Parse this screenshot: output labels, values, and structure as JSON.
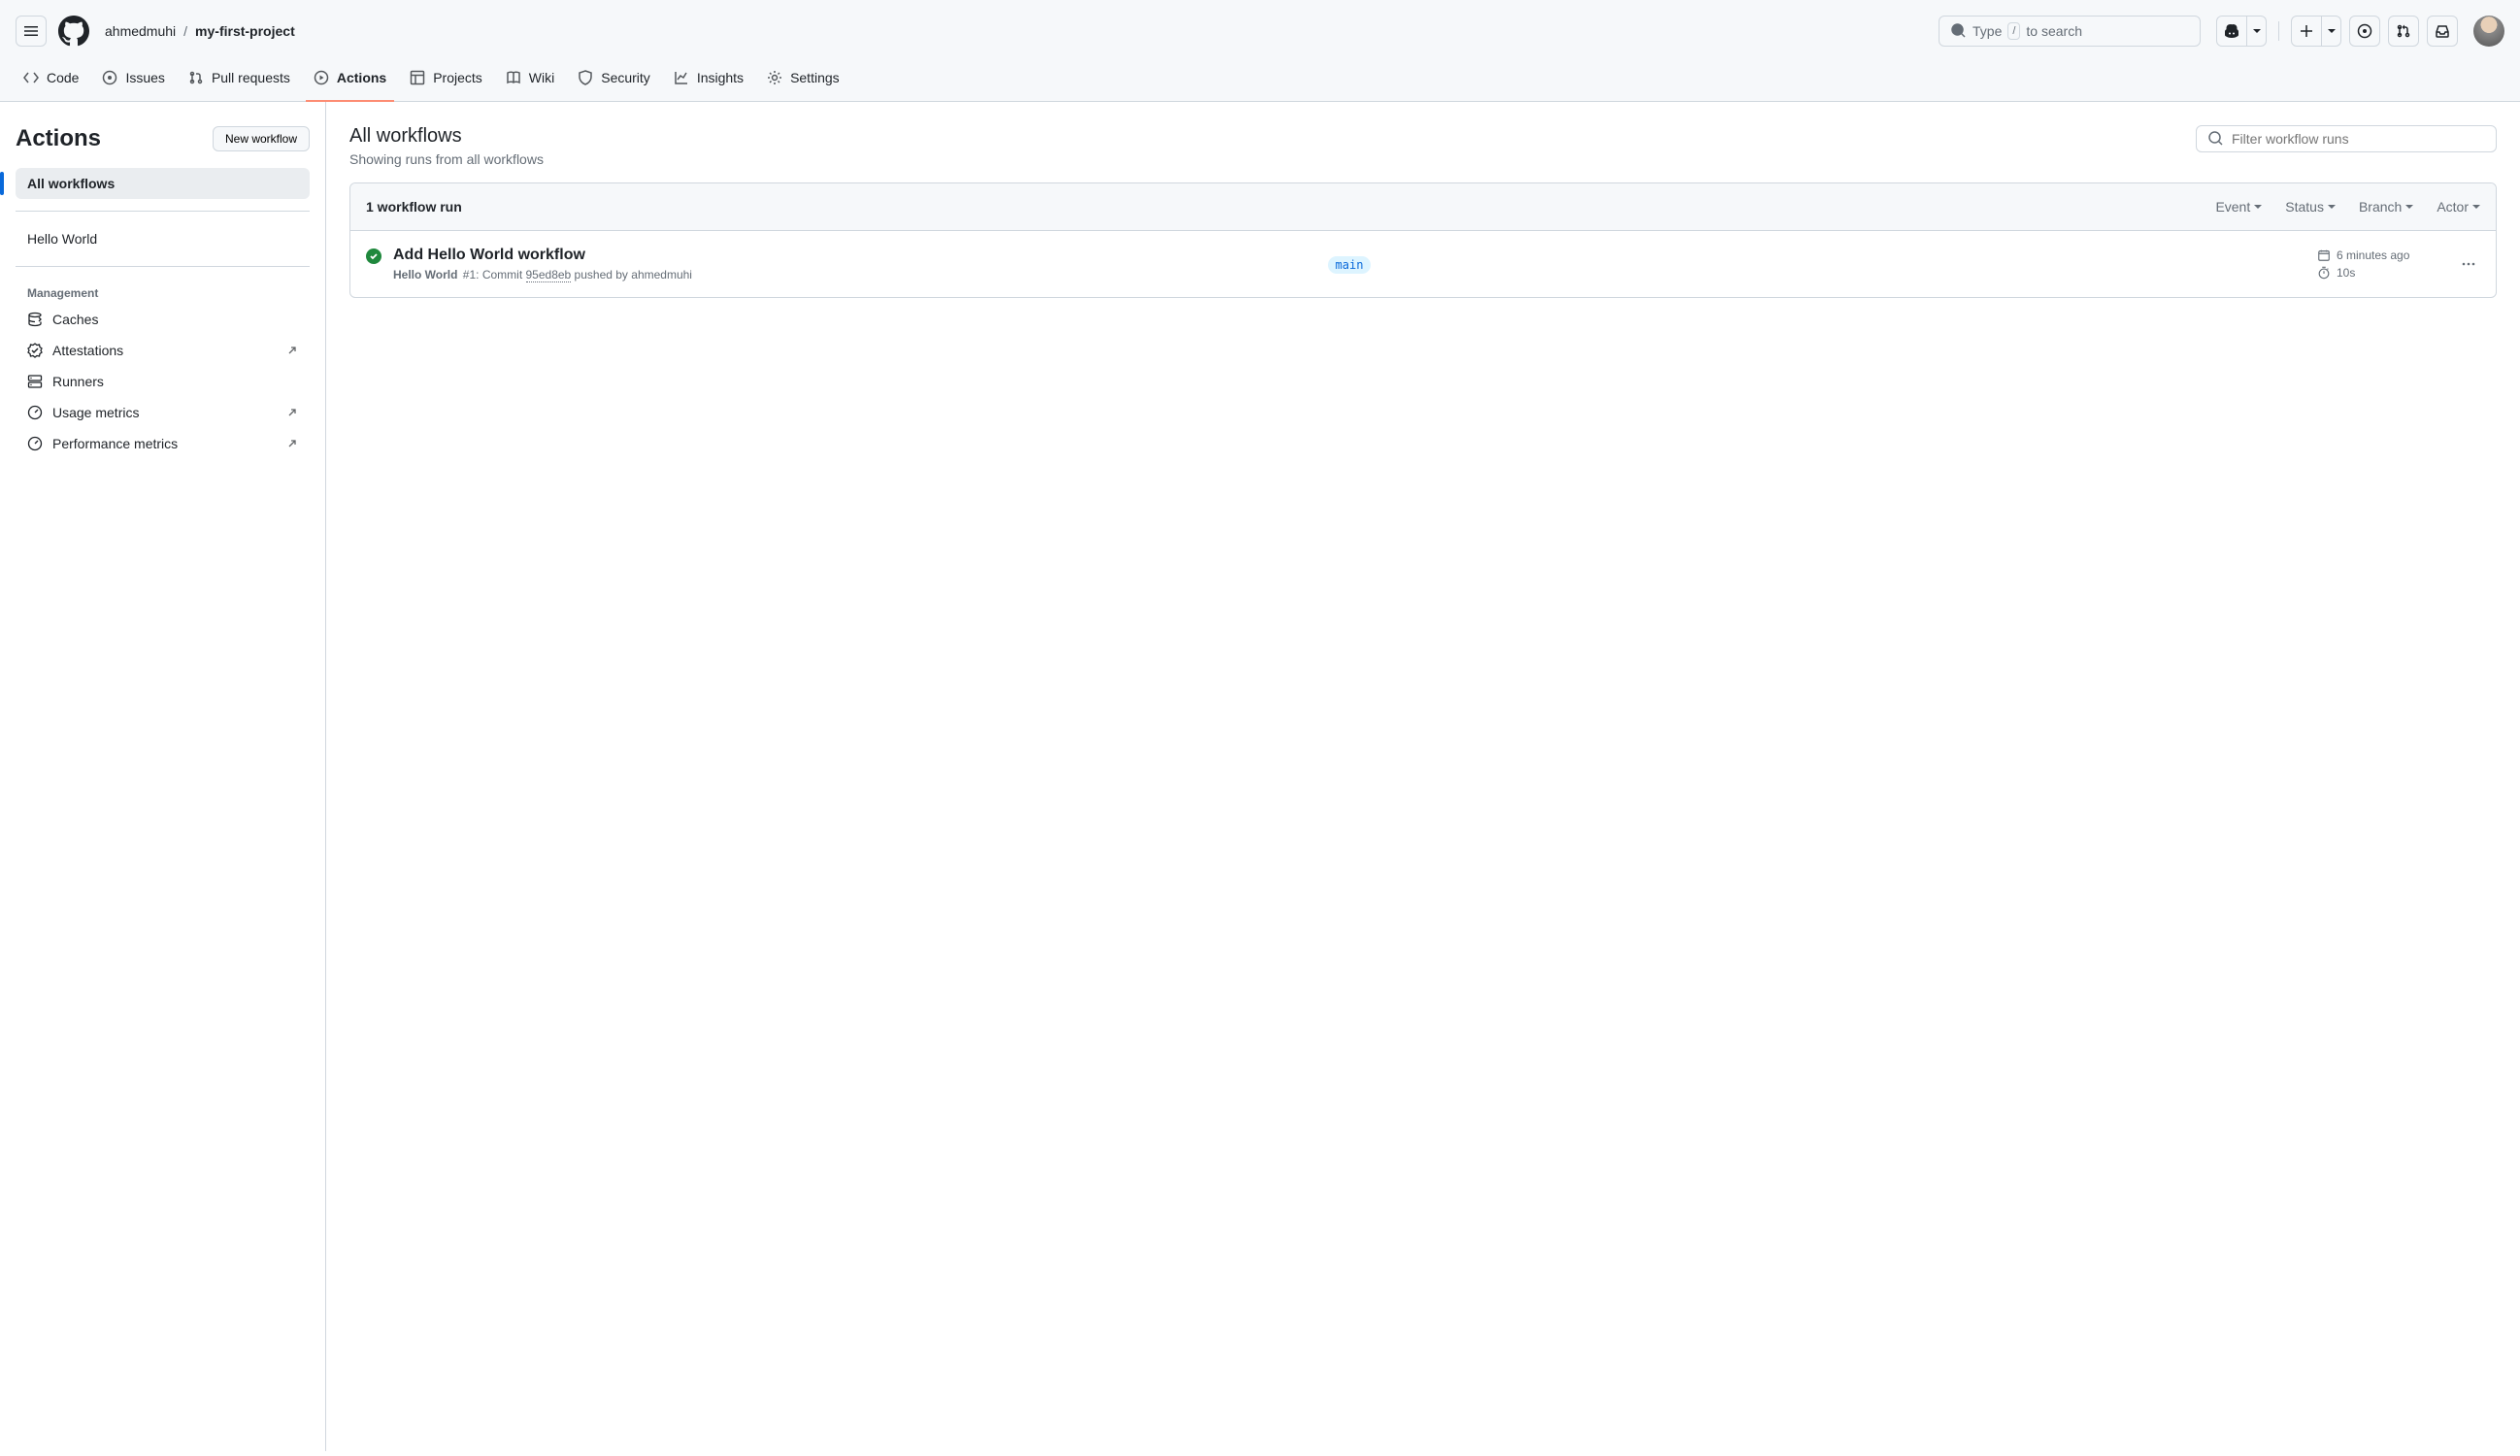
{
  "header": {
    "owner": "ahmedmuhi",
    "repo": "my-first-project",
    "search_prefix": "Type",
    "search_key": "/",
    "search_suffix": "to search"
  },
  "nav": {
    "code": "Code",
    "issues": "Issues",
    "pulls": "Pull requests",
    "actions": "Actions",
    "projects": "Projects",
    "wiki": "Wiki",
    "security": "Security",
    "insights": "Insights",
    "settings": "Settings"
  },
  "sidebar": {
    "title": "Actions",
    "new_workflow": "New workflow",
    "all_workflows": "All workflows",
    "workflows": [
      "Hello World"
    ],
    "management_label": "Management",
    "mgmt": {
      "caches": "Caches",
      "attestations": "Attestations",
      "runners": "Runners",
      "usage": "Usage metrics",
      "performance": "Performance metrics"
    }
  },
  "main": {
    "title": "All workflows",
    "subtitle": "Showing runs from all workflows",
    "filter_placeholder": "Filter workflow runs",
    "runs_count": "1 workflow run",
    "filters": {
      "event": "Event",
      "status": "Status",
      "branch": "Branch",
      "actor": "Actor"
    },
    "run": {
      "title": "Add Hello World workflow",
      "workflow": "Hello World",
      "number": "#1",
      "commit_prefix": ": Commit ",
      "sha": "95ed8eb",
      "pushed_by_prefix": " pushed by ",
      "actor": "ahmedmuhi",
      "branch": "main",
      "time_ago": "6 minutes ago",
      "duration": "10s"
    }
  }
}
